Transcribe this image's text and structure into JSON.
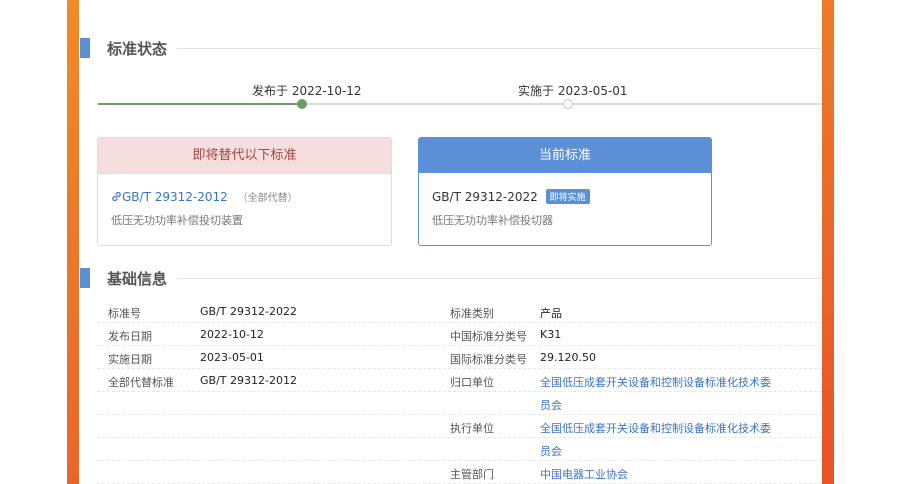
{
  "status_section": {
    "title": "标准状态",
    "published_label": "发布于 2022-10-12",
    "implemented_label": "实施于 2023-05-01"
  },
  "replaced_card": {
    "header": "即将替代以下标准",
    "code": "GB/T 29312-2012",
    "note": "（全部代替）",
    "name": "低压无功功率补偿投切装置"
  },
  "current_card": {
    "header": "当前标准",
    "code": "GB/T 29312-2022",
    "badge": "即将实施",
    "name": "低压无功功率补偿投切器"
  },
  "basic_section": {
    "title": "基础信息",
    "rows": [
      {
        "k1": "标准号",
        "v1": "GB/T 29312-2022",
        "k2": "标准类别",
        "v2": "产品",
        "v2_link": false
      },
      {
        "k1": "发布日期",
        "v1": "2022-10-12",
        "k2": "中国标准分类号",
        "v2": "K31",
        "v2_link": false
      },
      {
        "k1": "实施日期",
        "v1": "2023-05-01",
        "k2": "国际标准分类号",
        "v2": "29.120.50",
        "v2_link": false
      },
      {
        "k1": "全部代替标准",
        "v1": "GB/T 29312-2012",
        "k2": "归口单位",
        "v2": "全国低压成套开关设备和控制设备标准化技术委",
        "v2_link": true
      },
      {
        "k1": "",
        "v1": "",
        "k2": "",
        "v2": "员会",
        "v2_link": true
      },
      {
        "k1": "",
        "v1": "",
        "k2": "执行单位",
        "v2": "全国低压成套开关设备和控制设备标准化技术委",
        "v2_link": true
      },
      {
        "k1": "",
        "v1": "",
        "k2": "",
        "v2": "员会",
        "v2_link": true
      },
      {
        "k1": "",
        "v1": "",
        "k2": "主管部门",
        "v2": "中国电器工业协会",
        "v2_link": true
      }
    ]
  },
  "colors": {
    "accent_blue": "#5b8fd6",
    "link_blue": "#3b74c4",
    "timeline_green": "#6d9a66",
    "replaced_bg": "#f4dede",
    "replaced_text": "#a44",
    "side_bar_orange": "#ee7a2a"
  },
  "icons": {
    "link": "link-icon"
  }
}
